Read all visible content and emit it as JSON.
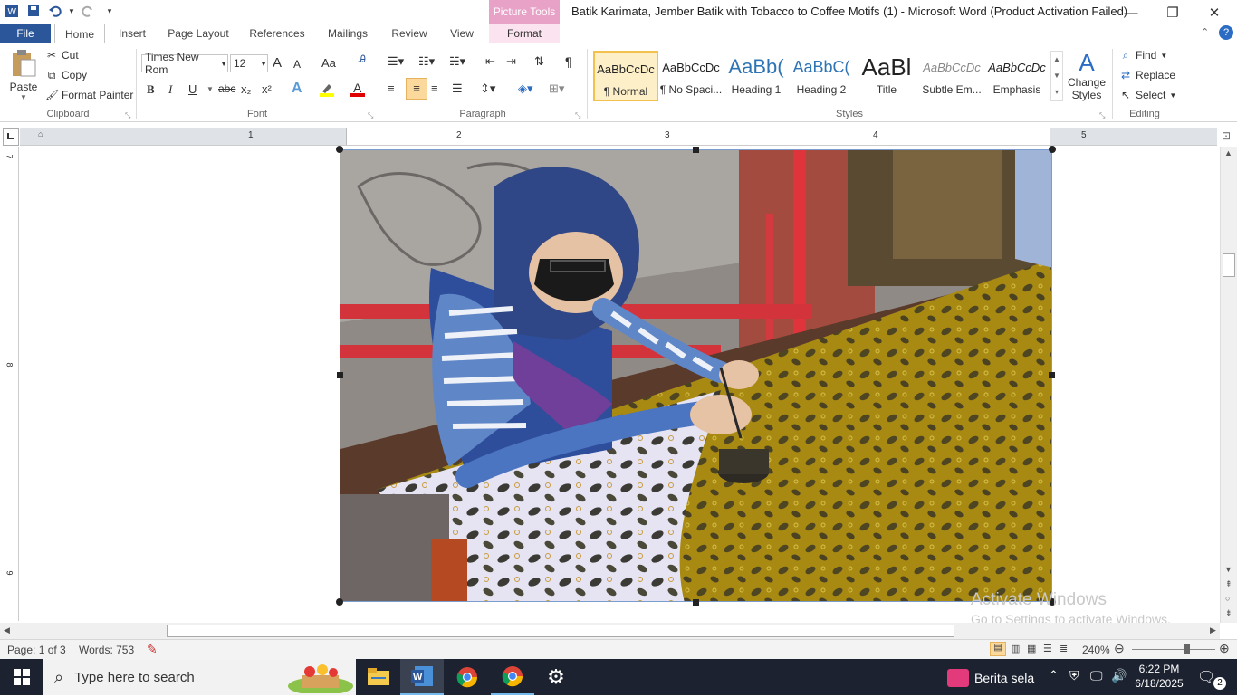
{
  "window": {
    "title": "Batik Karimata, Jember Batik with Tobacco to Coffee Motifs (1)  -  Microsoft Word (Product Activation Failed)",
    "context_tab_group": "Picture Tools"
  },
  "tabs": [
    "File",
    "Home",
    "Insert",
    "Page Layout",
    "References",
    "Mailings",
    "Review",
    "View",
    "Format"
  ],
  "clipboard": {
    "paste": "Paste",
    "cut": "Cut",
    "copy": "Copy",
    "format_painter": "Format Painter",
    "label": "Clipboard"
  },
  "font": {
    "family": "Times New Rom",
    "size": "12",
    "label": "Font",
    "buttons": {
      "bold": "B",
      "italic": "I",
      "underline": "U",
      "strike": "abc",
      "sub": "x₂",
      "sup": "x²",
      "grow": "A",
      "shrink": "A",
      "case": "Aa"
    }
  },
  "paragraph": {
    "label": "Paragraph"
  },
  "styles": {
    "label": "Styles",
    "items": [
      {
        "preview": "AaBbCcDc",
        "name": "¶ Normal"
      },
      {
        "preview": "AaBbCcDc",
        "name": "¶ No Spaci..."
      },
      {
        "preview": "AaBb(",
        "name": "Heading 1"
      },
      {
        "preview": "AaBbC(",
        "name": "Heading 2"
      },
      {
        "preview": "AaBl",
        "name": "Title"
      },
      {
        "preview": "AaBbCcDc",
        "name": "Subtle Em..."
      },
      {
        "preview": "AaBbCcDc",
        "name": "Emphasis"
      }
    ],
    "change_styles_1": "Change",
    "change_styles_2": "Styles"
  },
  "editing": {
    "label": "Editing",
    "find": "Find",
    "replace": "Replace",
    "select": "Select"
  },
  "ruler": {
    "h_numbers": [
      "1",
      "2",
      "3",
      "4",
      "5"
    ],
    "v_numbers": [
      "7",
      "8",
      "9"
    ]
  },
  "status": {
    "page": "Page: 1 of 3",
    "words": "Words: 753",
    "zoom": "240%"
  },
  "watermark": {
    "line1": "Activate Windows",
    "line2": "Go to Settings to activate Windows."
  },
  "taskbar": {
    "search_placeholder": "Type here to search",
    "news": "Berita sela",
    "time": "6:22 PM",
    "date": "6/18/2025",
    "notifications": "2"
  }
}
